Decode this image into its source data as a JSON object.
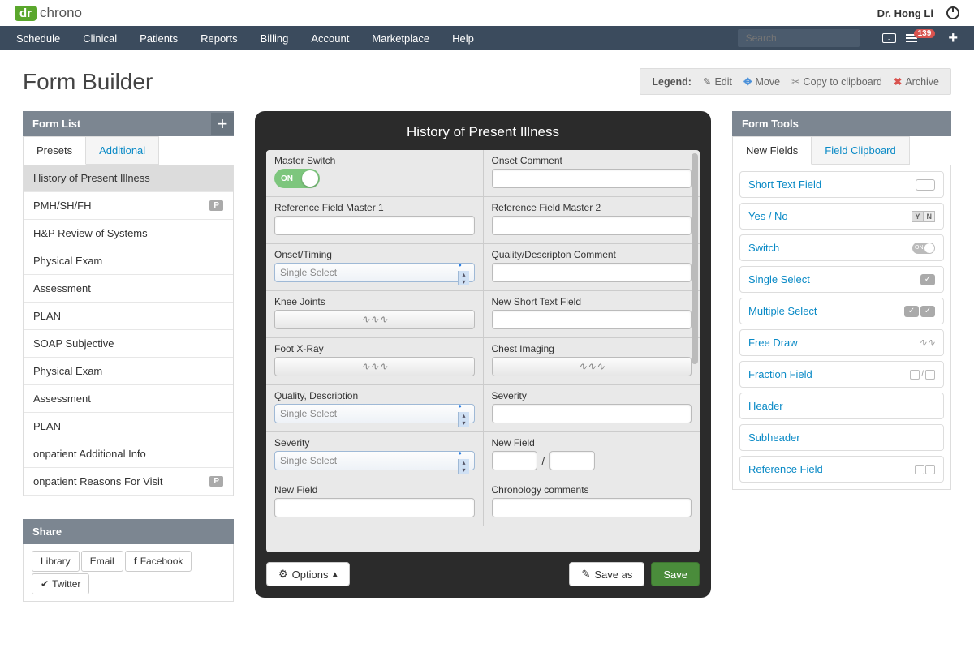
{
  "brand": {
    "dr": "dr",
    "chrono": "chrono"
  },
  "user_name": "Dr. Hong Li",
  "nav": {
    "items": [
      "Schedule",
      "Clinical",
      "Patients",
      "Reports",
      "Billing",
      "Account",
      "Marketplace",
      "Help"
    ],
    "search_placeholder": "Search",
    "badge_count": "139"
  },
  "page_title": "Form Builder",
  "legend": {
    "label": "Legend:",
    "edit": "Edit",
    "move": "Move",
    "copy": "Copy to clipboard",
    "archive": "Archive"
  },
  "left": {
    "title": "Form List",
    "tabs": {
      "presets": "Presets",
      "additional": "Additional"
    },
    "items": [
      {
        "label": "History of Present Illness",
        "selected": true
      },
      {
        "label": "PMH/SH/FH",
        "p": true
      },
      {
        "label": "H&P Review of Systems"
      },
      {
        "label": "Physical Exam"
      },
      {
        "label": "Assessment"
      },
      {
        "label": "PLAN"
      },
      {
        "label": "SOAP Subjective"
      },
      {
        "label": "Physical Exam"
      },
      {
        "label": "Assessment"
      },
      {
        "label": "PLAN"
      },
      {
        "label": "onpatient Additional Info"
      },
      {
        "label": "onpatient Reasons For Visit",
        "p": true
      }
    ],
    "share": {
      "title": "Share",
      "library": "Library",
      "email": "Email",
      "facebook": "Facebook",
      "twitter": "Twitter"
    }
  },
  "center": {
    "title": "History of Present Illness",
    "rows": [
      {
        "l": {
          "label": "Master Switch",
          "type": "switch",
          "value": "ON"
        },
        "r": {
          "label": "Onset Comment",
          "type": "text"
        }
      },
      {
        "l": {
          "label": "Reference Field Master 1",
          "type": "text"
        },
        "r": {
          "label": "Reference Field Master 2",
          "type": "text"
        }
      },
      {
        "l": {
          "label": "Onset/Timing",
          "type": "select",
          "value": "Single Select"
        },
        "r": {
          "label": "Quality/Descripton Comment",
          "type": "text"
        }
      },
      {
        "l": {
          "label": "Knee Joints",
          "type": "draw"
        },
        "r": {
          "label": "New Short Text Field",
          "type": "text"
        }
      },
      {
        "l": {
          "label": "Foot X-Ray",
          "type": "draw"
        },
        "r": {
          "label": "Chest Imaging",
          "type": "draw"
        }
      },
      {
        "l": {
          "label": "Quality, Description",
          "type": "select",
          "value": "Single Select"
        },
        "r": {
          "label": "Severity",
          "type": "text"
        }
      },
      {
        "l": {
          "label": "Severity",
          "type": "select",
          "value": "Single Select"
        },
        "r": {
          "label": "New Field",
          "type": "fraction",
          "sep": "/"
        }
      },
      {
        "l": {
          "label": "New Field",
          "type": "text"
        },
        "r": {
          "label": "Chronology comments",
          "type": "text"
        }
      }
    ],
    "options": "Options",
    "save_as": "Save as",
    "save": "Save"
  },
  "right": {
    "title": "Form Tools",
    "tabs": {
      "new": "New Fields",
      "clip": "Field Clipboard"
    },
    "tools": [
      {
        "label": "Short Text Field",
        "icon": "box"
      },
      {
        "label": "Yes / No",
        "icon": "yn"
      },
      {
        "label": "Switch",
        "icon": "switch",
        "switch_text": "ON"
      },
      {
        "label": "Single Select",
        "icon": "check1"
      },
      {
        "label": "Multiple Select",
        "icon": "check2"
      },
      {
        "label": "Free Draw",
        "icon": "draw"
      },
      {
        "label": "Fraction Field",
        "icon": "frac"
      },
      {
        "label": "Header",
        "icon": ""
      },
      {
        "label": "Subheader",
        "icon": ""
      },
      {
        "label": "Reference Field",
        "icon": "ref"
      }
    ]
  },
  "p_badge": "P"
}
